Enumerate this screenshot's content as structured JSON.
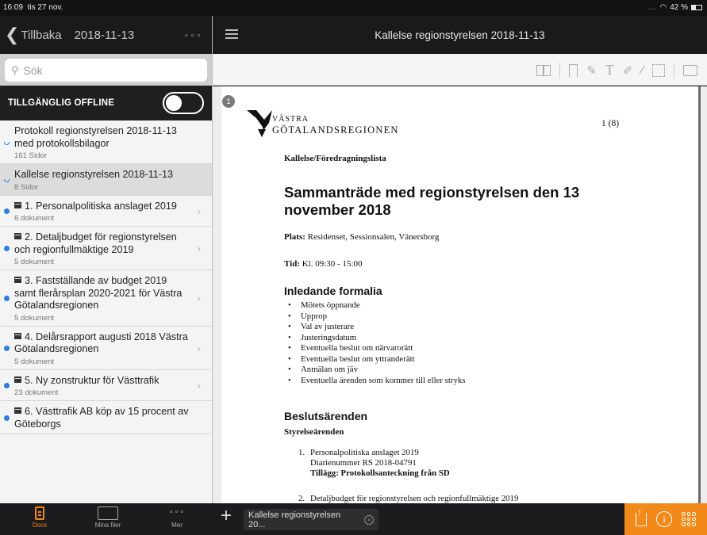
{
  "status": {
    "time": "16:09",
    "date": "tis 27 nov.",
    "signal": "....",
    "battery_pct": "42 %",
    "battery_level": 0.42
  },
  "sidebar": {
    "back_label": "Tillbaka",
    "header_date": "2018-11-13",
    "more_dots": "∘∘∘",
    "search_placeholder": "Sök",
    "offline_label": "TILLGÄNGLIG OFFLINE",
    "offline_enabled": false,
    "items": [
      {
        "title": "Protokoll  regionstyrelsen 2018-11-13 med protokollsbilagor",
        "sub": "161 Sidor",
        "kind": "doc",
        "selected": false
      },
      {
        "title": "Kallelse regionstyrelsen 2018-11-13",
        "sub": "8 Sidor",
        "kind": "doc",
        "selected": true
      },
      {
        "title": "1. Personalpolitiska anslaget 2019",
        "sub": "6 dokument",
        "kind": "folder"
      },
      {
        "title": "2. Detaljbudget för regionstyrelsen och regionfullmäktige 2019",
        "sub": "5 dokument",
        "kind": "folder"
      },
      {
        "title": "3. Fastställande av budget 2019 samt flerårsplan 2020-2021 för Västra Götalandsregionen",
        "sub": "5 dokument",
        "kind": "folder"
      },
      {
        "title": "4. Delårsrapport augusti 2018 Västra Götalandsregionen",
        "sub": "5 dokument",
        "kind": "folder"
      },
      {
        "title": "5. Ny zonstruktur för Västtrafik",
        "sub": "23 dokument",
        "kind": "folder"
      },
      {
        "title": "6. Västtrafik AB köp av 15 procent av Göteborgs",
        "sub": "",
        "kind": "folder"
      }
    ]
  },
  "bottom": {
    "tabs": [
      {
        "label": "Docs",
        "active": true
      },
      {
        "label": "Mina filer",
        "active": false
      },
      {
        "label": "Mer",
        "active": false
      }
    ],
    "plus": "+",
    "doc_tab_label": "Kallelse regionstyrelsen 20...",
    "doc_tab_close": "×",
    "info_glyph": "i"
  },
  "main": {
    "title": "Kallelse regionstyrelsen 2018-11-13",
    "tools": [
      "book-icon",
      "bookmark-icon",
      "highlighter-icon",
      "text-icon",
      "pen-icon",
      "line-icon",
      "rectangle-icon",
      "comment-icon"
    ],
    "text_tool_glyph": "T"
  },
  "document": {
    "page_badge": "1",
    "brand_line1": "VÄSTRA",
    "brand_line2": "GÖTALANDSREGIONEN",
    "page_number": "1 (8)",
    "kallelse": "Kallelse/Föredragningslista",
    "heading": "Sammanträde med regionstyrelsen den 13 november 2018",
    "plats_label": "Plats:",
    "plats_value": "Residenset, Sessionsalen, Vänersborg",
    "tid_label": "Tid:",
    "tid_value": "Kl. 09:30 - 15:00",
    "section1": "Inledande formalia",
    "bullets": [
      "Mötets öppnande",
      "Upprop",
      "Val av justerare",
      "Justeringsdatum",
      "Eventuella beslut om närvarorätt",
      "Eventuella beslut om yttranderätt",
      "Anmälan om jäv",
      "Eventuella ärenden som kommer till eller stryks"
    ],
    "section2": "Beslutsärenden",
    "subsection": "Styrelseärenden",
    "list": [
      {
        "num": "1.",
        "title": "Personalpolitiska anslaget 2019",
        "diarie": "Diarienummer RS 2018-04791",
        "note": "Tillägg: Protokollsanteckning från SD"
      },
      {
        "num": "2.",
        "title": "Detaljbudget för regionstyrelsen och regionfullmäktige 2019"
      }
    ]
  },
  "colors": {
    "accent": "#f28a1a",
    "dot": "#2d7ee3",
    "dark": "#1a1a1a"
  }
}
